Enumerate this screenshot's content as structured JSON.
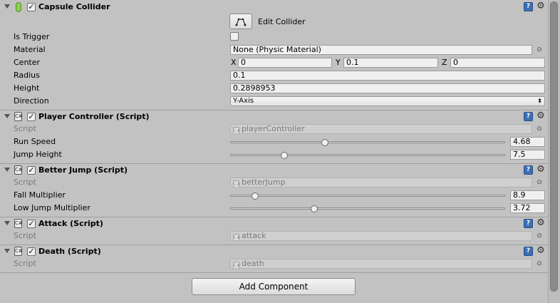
{
  "capsule_collider": {
    "title": "Capsule Collider",
    "enabled": true,
    "edit_collider_label": "Edit Collider",
    "is_trigger_label": "Is Trigger",
    "is_trigger": false,
    "material_label": "Material",
    "material_value": "None (Physic Material)",
    "center_label": "Center",
    "center": {
      "x_label": "X",
      "x": "0",
      "y_label": "Y",
      "y": "0.1",
      "z_label": "Z",
      "z": "0"
    },
    "radius_label": "Radius",
    "radius": "0.1",
    "height_label": "Height",
    "height": "0.2898953",
    "direction_label": "Direction",
    "direction": "Y-Axis"
  },
  "player_controller": {
    "title": "Player Controller (Script)",
    "enabled": true,
    "script_label": "Script",
    "script_value": "playerController",
    "run_speed_label": "Run Speed",
    "run_speed": "4.68",
    "run_speed_fraction": 0.34,
    "jump_height_label": "Jump Height",
    "jump_height": "7.5",
    "jump_height_fraction": 0.19
  },
  "better_jump": {
    "title": "Better Jump (Script)",
    "enabled": true,
    "script_label": "Script",
    "script_value": "betterJump",
    "fall_multiplier_label": "Fall Multiplier",
    "fall_multiplier": "8.9",
    "fall_multiplier_fraction": 0.08,
    "low_jump_label": "Low Jump Multiplier",
    "low_jump": "3.72",
    "low_jump_fraction": 0.3
  },
  "attack": {
    "title": "Attack (Script)",
    "enabled": true,
    "script_label": "Script",
    "script_value": "attack"
  },
  "death": {
    "title": "Death (Script)",
    "enabled": true,
    "script_label": "Script",
    "script_value": "death"
  },
  "add_component_label": "Add Component",
  "icons": {
    "help": "help-icon",
    "settings": "gear-icon",
    "object_picker": "object-picker-icon",
    "script": "script-icon",
    "capsule": "capsule-collider-icon"
  }
}
